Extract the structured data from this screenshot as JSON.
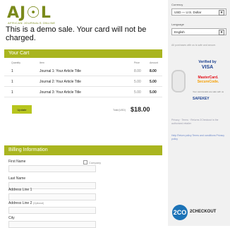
{
  "header": {
    "logo_text": "AJ☉L",
    "logo_sub": "AFRICAN JOURNALS ONLINE",
    "demo_notice": "This is a demo sale. Your card will not be charged."
  },
  "cart": {
    "title": "Your Cart",
    "columns": [
      "Quantity",
      "Item",
      "Price",
      "Amount"
    ],
    "rows": [
      {
        "qty": "1",
        "title": "Journal 1: Your Article Title",
        "price": "8.00",
        "amount": "8.00"
      },
      {
        "qty": "1",
        "title": "Journal 2: Your Article Title",
        "price": "5.00",
        "amount": "5.00"
      },
      {
        "qty": "1",
        "title": "Journal 3: Your Article Title",
        "price": "5.00",
        "amount": "5.00"
      }
    ],
    "update_label": "Update",
    "total_label": "Total (USD)",
    "total": "$18.00"
  },
  "billing": {
    "title": "Billing Information",
    "first_name": "First Name",
    "company_label": "Company",
    "last_name": "Last Name",
    "address1": "Address Line 1",
    "address2": "Address Line 2",
    "address2_opt": "(Optional)",
    "city": "City"
  },
  "sidebar": {
    "currency_label": "Currency",
    "currency_value": "USD — U.S. Dollar",
    "language_label": "Language",
    "language_value": "English",
    "protect_note": "All purchases with us is safe and secure.",
    "visa_line1": "Verified by",
    "visa_line2": "VISA",
    "mc_line1": "MasterCard.",
    "mc_line2": "SecureCode.",
    "safe_text": "Your card details are safe with us",
    "safekey": "SAFEKEY",
    "links_grey": "Privacy · Terms · Returns 2Checkout is the authorized retailer",
    "links_blue": "Help Return policy Terms and conditions Privacy policy"
  },
  "footer": {
    "co_logo": "2CO",
    "co_text": "2CHECKOUT"
  },
  "colors": {
    "accent": "#a9b51f",
    "brand_blue": "#1c73b7"
  }
}
